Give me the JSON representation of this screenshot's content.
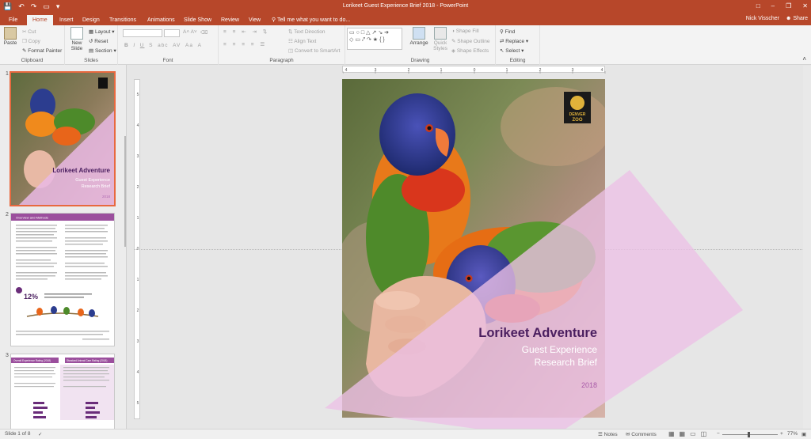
{
  "title_bar": {
    "document_title": "Lorikeet Guest Experience Brief 2018 - PowerPoint",
    "controls": [
      "–",
      "❐",
      "✕"
    ]
  },
  "tabs": [
    "File",
    "Home",
    "Insert",
    "Design",
    "Transitions",
    "Animations",
    "Slide Show",
    "Review",
    "View"
  ],
  "tell_me": "Tell me what you want to do...",
  "user": "Nick Visscher",
  "share": "Share",
  "ribbon": {
    "clipboard": {
      "paste": "Paste",
      "cut": "Cut",
      "copy": "Copy",
      "format_painter": "Format Painter",
      "label": "Clipboard"
    },
    "slides": {
      "new_slide": "New Slide",
      "layout": "Layout",
      "reset": "Reset",
      "section": "Section",
      "label": "Slides"
    },
    "font": {
      "label": "Font",
      "styles": [
        "B",
        "I",
        "U",
        "S",
        "abc",
        "AV",
        "Aa",
        "A"
      ]
    },
    "paragraph": {
      "label": "Paragraph",
      "text_direction": "Text Direction",
      "align_text": "Align Text",
      "smartart": "Convert to SmartArt"
    },
    "drawing": {
      "arrange": "Arrange",
      "quick_styles": "Quick Styles",
      "shape_fill": "Shape Fill",
      "shape_outline": "Shape Outline",
      "shape_effects": "Shape Effects",
      "label": "Drawing"
    },
    "editing": {
      "find": "Find",
      "replace": "Replace",
      "select": "Select",
      "label": "Editing"
    }
  },
  "thumbnails": [
    {
      "num": "1",
      "title": "Lorikeet Adventure",
      "sub1": "Guest Experience",
      "sub2": "Research Brief",
      "year": "2018"
    },
    {
      "num": "2",
      "heading": "Overview and Methods",
      "stat": "12%"
    },
    {
      "num": "3",
      "heading_left": "Overall Experience Rating (2018)",
      "heading_right": "Standard Animal Care Rating (2018)"
    }
  ],
  "slide": {
    "logo_line1": "DENVER",
    "logo_line2": "ZOO",
    "title": "Lorikeet Adventure",
    "subtitle1": "Guest Experience",
    "subtitle2": "Research Brief",
    "year": "2018"
  },
  "ruler": {
    "h": [
      "4",
      "3",
      "2",
      "1",
      "0",
      "1",
      "2",
      "3",
      "4"
    ],
    "v": [
      "5",
      "4",
      "3",
      "2",
      "1",
      "0",
      "1",
      "2",
      "3",
      "4",
      "5"
    ]
  },
  "status": {
    "slide_of": "Slide 1 of 8",
    "notes": "Notes",
    "comments": "Comments",
    "zoom": "77%"
  },
  "colors": {
    "accent": "#b7472a",
    "purple": "#4a1e5f",
    "lilac": "#e6b8df"
  }
}
